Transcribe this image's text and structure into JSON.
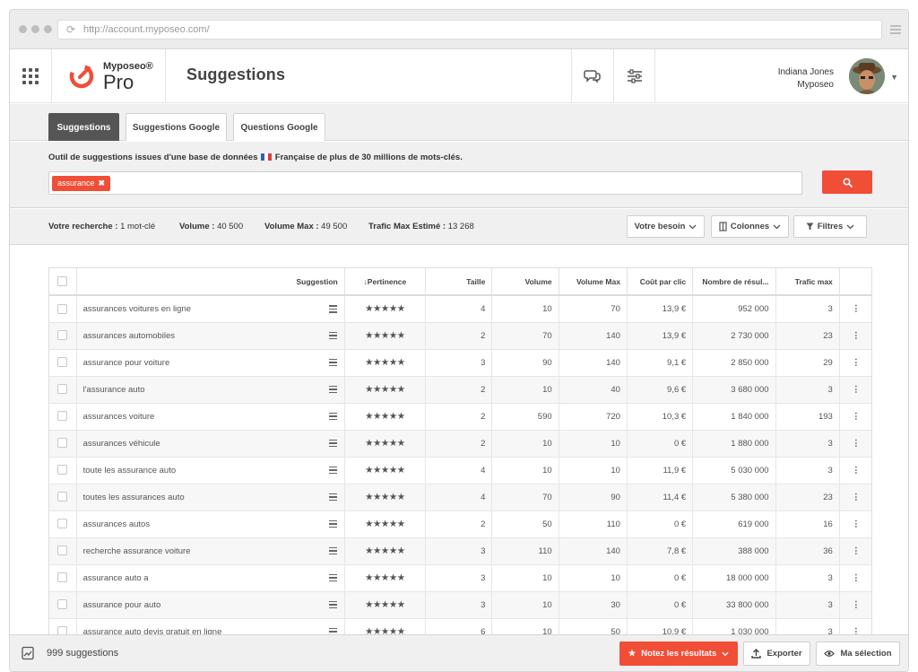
{
  "browser": {
    "url": "http://account.myposeo.com/"
  },
  "header": {
    "logo_brand": "Myposeo®",
    "logo_product": "Pro",
    "title": "Suggestions",
    "user_name": "Indiana Jones",
    "user_org": "Myposeo"
  },
  "tabs": [
    {
      "label": "Suggestions",
      "active": true
    },
    {
      "label": "Suggestions Google",
      "active": false
    },
    {
      "label": "Questions Google",
      "active": false
    }
  ],
  "search": {
    "description_before": "Outil de suggestions issues d'une base de données",
    "description_after": "Française de plus de 30 millions de mots-clés.",
    "chip": "assurance"
  },
  "stats": {
    "recherche_label": "Votre recherche :",
    "recherche_value": "1 mot-clé",
    "volume_label": "Volume :",
    "volume_value": "40 500",
    "volmax_label": "Volume Max :",
    "volmax_value": "49 500",
    "trafic_label": "Trafic Max Estimé :",
    "trafic_value": "13 268"
  },
  "filters": {
    "besoin": "Votre besoin",
    "colonnes": "Colonnes",
    "filtres": "Filtres"
  },
  "table": {
    "headers": [
      "Suggestion",
      "Pertinence",
      "Taille",
      "Volume",
      "Volume Max",
      "Coût par clic",
      "Nombre de résul...",
      "Trafic max"
    ],
    "rows": [
      [
        "assurances voitures en ligne",
        "4",
        "10",
        "70",
        "13,9 €",
        "952 000",
        "3"
      ],
      [
        "assurances automobiles",
        "2",
        "70",
        "140",
        "13,9 €",
        "2 730 000",
        "23"
      ],
      [
        "assurance pour voiture",
        "3",
        "90",
        "140",
        "9,1 €",
        "2 850 000",
        "29"
      ],
      [
        "l'assurance auto",
        "2",
        "10",
        "40",
        "9,6 €",
        "3 680 000",
        "3"
      ],
      [
        "assurances voiture",
        "2",
        "590",
        "720",
        "10,3 €",
        "1 840 000",
        "193"
      ],
      [
        "assurances véhicule",
        "2",
        "10",
        "10",
        "0 €",
        "1 880 000",
        "3"
      ],
      [
        "toute les assurance auto",
        "4",
        "10",
        "10",
        "11,9 €",
        "5 030 000",
        "3"
      ],
      [
        "toutes les assurances auto",
        "4",
        "70",
        "90",
        "11,4 €",
        "5 380 000",
        "23"
      ],
      [
        "assurances autos",
        "2",
        "50",
        "110",
        "0 €",
        "619 000",
        "16"
      ],
      [
        "recherche assurance voiture",
        "3",
        "110",
        "140",
        "7,8 €",
        "388 000",
        "36"
      ],
      [
        "assurance auto a",
        "3",
        "10",
        "10",
        "0 €",
        "18 000 000",
        "3"
      ],
      [
        "assurance pour auto",
        "3",
        "10",
        "30",
        "0 €",
        "33 800 000",
        "3"
      ],
      [
        "assurance auto devis gratuit en ligne",
        "6",
        "10",
        "50",
        "10,9 €",
        "1 030 000",
        "3"
      ]
    ]
  },
  "footer": {
    "count": "999 suggestions",
    "rate_label": "Notez les résultats",
    "export_label": "Exporter",
    "selection_label": "Ma sélection"
  },
  "colors": {
    "accent": "#f04e37",
    "tab_active": "#555555"
  }
}
